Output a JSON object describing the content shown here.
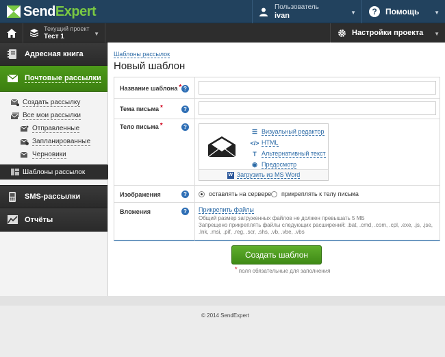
{
  "header": {
    "logo_text_1": "Send",
    "logo_text_2": "Expert",
    "user_label": "Пользователь",
    "user_name": "ivan",
    "help_label": "Помощь"
  },
  "project_bar": {
    "current_project_label": "Текущий проект",
    "current_project_name": "Тест 1",
    "settings_label": "Настройки проекта"
  },
  "sidebar": {
    "address_book": "Адресная книга",
    "mailings": "Почтовые рассылки",
    "create_mailing": "Создать рассылку",
    "all_mailings": "Все мои рассылки",
    "sent": "Отправленные",
    "scheduled": "Запланированные",
    "drafts": "Черновики",
    "templates": "Шаблоны рассылок",
    "sms": "SMS-рассылки",
    "reports": "Отчёты"
  },
  "main": {
    "breadcrumb": "Шаблоны рассылок",
    "title": "Новый шаблон",
    "form": {
      "template_name_label": "Название шаблона",
      "template_name_value": "",
      "subject_label": "Тема письма",
      "subject_value": "",
      "body_label": "Тело письма",
      "editor_links": {
        "visual": "Визуальный редактор",
        "html": "HTML",
        "alt_text": "Альтернативный текст",
        "preview": "Предосмотр",
        "word": "Загрузить из MS Word"
      },
      "images_label": "Изображения",
      "images_options": {
        "server": "оставлять на сервере",
        "attach": "прикреплять к телу письма",
        "selected": "server"
      },
      "attachments_label": "Вложения",
      "attach_files": "Прикрепить файлы",
      "attach_note_1": "Общий размер загруженных файлов не должен превышать 5 МБ",
      "attach_note_2": "Запрещено прикреплять файлы следующих расширений: .bat, .cmd, .com, .cpl, .exe, .js, .jse,",
      "attach_note_3": ".lnk, .msi, .pif, .reg, .scr, .shs, .vb, .vbe, .vbs"
    },
    "submit_label": "Создать шаблон",
    "required_note": "поля обязательные для заполнения"
  },
  "footer": {
    "copyright": "© 2014 SendExpert"
  },
  "colors": {
    "topbar": "#22425e",
    "accent_green": "#4d9a1a",
    "link": "#2b6aa6",
    "required": "#d0021b"
  }
}
